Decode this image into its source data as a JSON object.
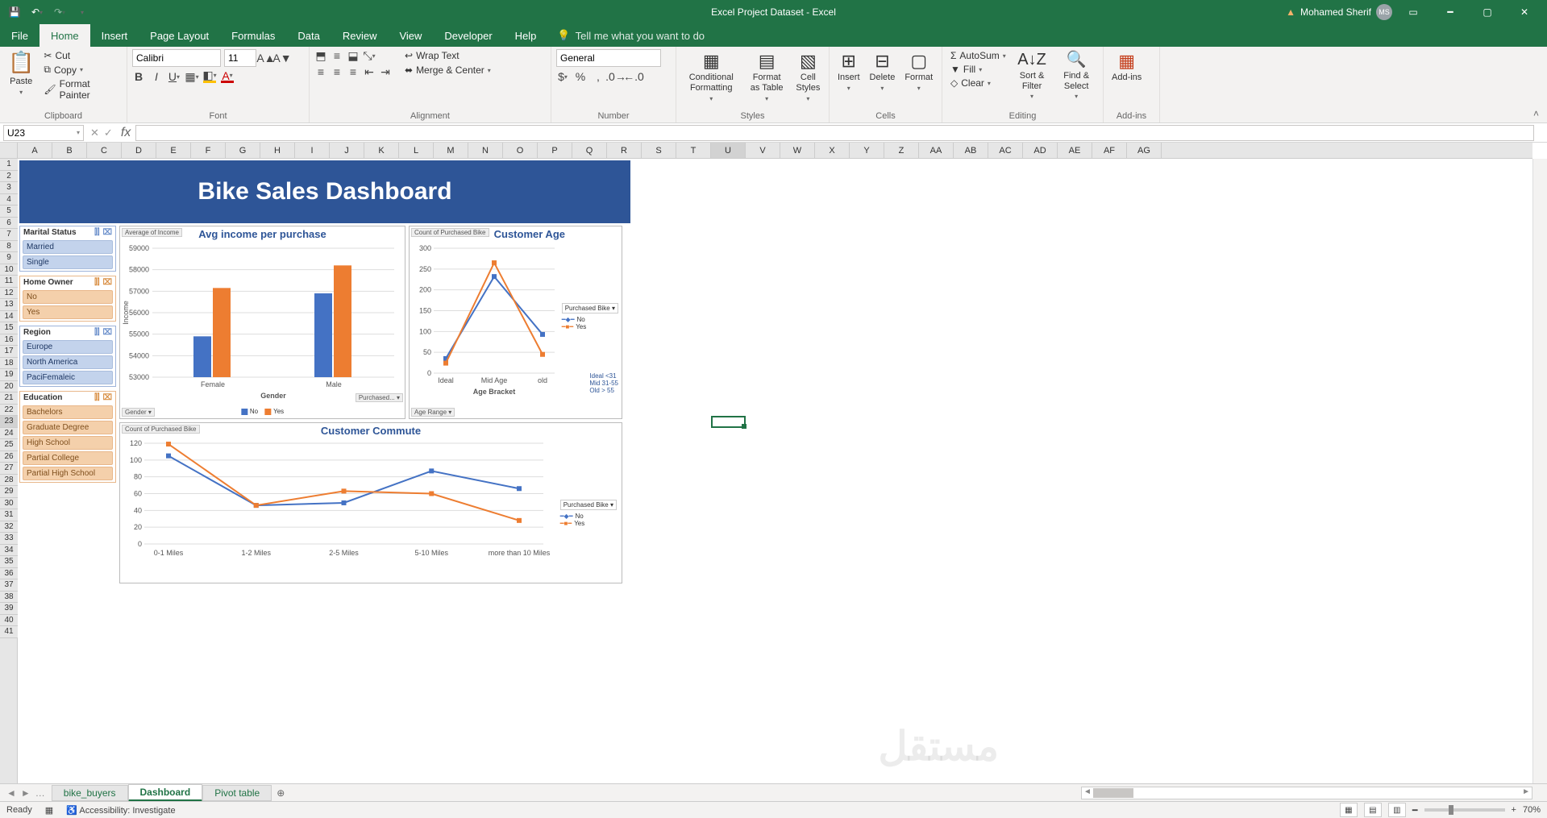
{
  "app_title": "Excel Project Dataset  -  Excel",
  "user_name": "Mohamed Sherif",
  "user_initials": "MS",
  "qat": {
    "save": "💾",
    "undo": "↶",
    "redo": "↷"
  },
  "ribbon_tabs": [
    "File",
    "Home",
    "Insert",
    "Page Layout",
    "Formulas",
    "Data",
    "Review",
    "View",
    "Developer",
    "Help"
  ],
  "active_tab": "Home",
  "tellme": "Tell me what you want to do",
  "clipboard": {
    "paste": "Paste",
    "cut": "Cut",
    "copy": "Copy",
    "format_painter": "Format Painter",
    "label": "Clipboard"
  },
  "font": {
    "name": "Calibri",
    "size": "11",
    "label": "Font"
  },
  "alignment": {
    "wrap": "Wrap Text",
    "merge": "Merge & Center",
    "label": "Alignment"
  },
  "number": {
    "format": "General",
    "label": "Number"
  },
  "styles": {
    "cond": "Conditional Formatting",
    "fat": "Format as Table",
    "cell": "Cell Styles",
    "label": "Styles"
  },
  "cells": {
    "insert": "Insert",
    "delete": "Delete",
    "format": "Format",
    "label": "Cells"
  },
  "editing": {
    "autosum": "AutoSum",
    "fill": "Fill",
    "clear": "Clear",
    "sort": "Sort & Filter",
    "find": "Find & Select",
    "label": "Editing"
  },
  "addins": {
    "btn": "Add-ins",
    "label": "Add-ins"
  },
  "namebox": "U23",
  "columns": [
    "A",
    "B",
    "C",
    "D",
    "E",
    "F",
    "G",
    "H",
    "I",
    "J",
    "K",
    "L",
    "M",
    "N",
    "O",
    "P",
    "Q",
    "R",
    "S",
    "T",
    "U",
    "V",
    "W",
    "X",
    "Y",
    "Z",
    "AA",
    "AB",
    "AC",
    "AD",
    "AE",
    "AF",
    "AG"
  ],
  "active_col_idx": 20,
  "rows_visible": 41,
  "active_row": 23,
  "sheet_tabs": [
    "bike_buyers",
    "Dashboard",
    "Pivot table"
  ],
  "active_sheet": "Dashboard",
  "status_ready": "Ready",
  "status_acc": "Accessibility: Investigate",
  "zoom": "70%",
  "dashboard_title": "Bike Sales Dashboard",
  "slicers": [
    {
      "title": "Marital Status",
      "style": "blue",
      "items": [
        "Married",
        "Single"
      ]
    },
    {
      "title": "Home Owner",
      "style": "orange",
      "items": [
        "No",
        "Yes"
      ]
    },
    {
      "title": "Region",
      "style": "blue",
      "items": [
        "Europe",
        "North America",
        "PaciFemaleic"
      ]
    },
    {
      "title": "Education",
      "style": "orange",
      "items": [
        "Bachelors",
        "Graduate Degree",
        "High School",
        "Partial College",
        "Partial High School"
      ]
    }
  ],
  "legend_key_note": [
    "Ideal <31",
    "Mid 31-55",
    "Old > 55"
  ],
  "chart_data": [
    {
      "id": "income",
      "type": "bar",
      "title": "Avg income per purchase",
      "ylabel": "Income",
      "xlabel": "Gender",
      "top_label": "Average of Income",
      "ylim": [
        53000,
        59000
      ],
      "yticks": [
        53000,
        54000,
        55000,
        56000,
        57000,
        58000,
        59000
      ],
      "categories": [
        "Female",
        "Male"
      ],
      "series": [
        {
          "name": "No",
          "color": "#4472c4",
          "values": [
            54900,
            56900
          ]
        },
        {
          "name": "Yes",
          "color": "#ed7d31",
          "values": [
            57150,
            58200
          ]
        }
      ],
      "dropdowns": [
        "Gender",
        "Purchased..."
      ],
      "legend_items": [
        "No",
        "Yes"
      ]
    },
    {
      "id": "age",
      "type": "line",
      "title": "Customer Age",
      "top_label": "Count of Purchased Bike",
      "xlabel": "Age Bracket",
      "ylim": [
        0,
        300
      ],
      "yticks": [
        0,
        50,
        100,
        150,
        200,
        250,
        300
      ],
      "categories": [
        "Ideal",
        "Mid Age",
        "old"
      ],
      "series": [
        {
          "name": "No",
          "color": "#4472c4",
          "values": [
            35,
            232,
            93
          ]
        },
        {
          "name": "Yes",
          "color": "#ed7d31",
          "values": [
            24,
            265,
            45
          ]
        }
      ],
      "dropdowns": [
        "Age Range"
      ],
      "legend_header": "Purchased Bike",
      "legend_items": [
        "No",
        "Yes"
      ]
    },
    {
      "id": "commute",
      "type": "line",
      "title": "Customer Commute",
      "top_label": "Count of Purchased Bike",
      "ylim": [
        0,
        120
      ],
      "yticks": [
        0,
        20,
        40,
        60,
        80,
        100,
        120
      ],
      "categories": [
        "0-1 Miles",
        "1-2 Miles",
        "2-5 Miles",
        "5-10 Miles",
        "more than 10 Miles"
      ],
      "series": [
        {
          "name": "No",
          "color": "#4472c4",
          "values": [
            105,
            46,
            49,
            87,
            66
          ]
        },
        {
          "name": "Yes",
          "color": "#ed7d31",
          "values": [
            119,
            46,
            63,
            60,
            28
          ]
        }
      ],
      "legend_header": "Purchased Bike",
      "legend_items": [
        "No",
        "Yes"
      ]
    }
  ]
}
